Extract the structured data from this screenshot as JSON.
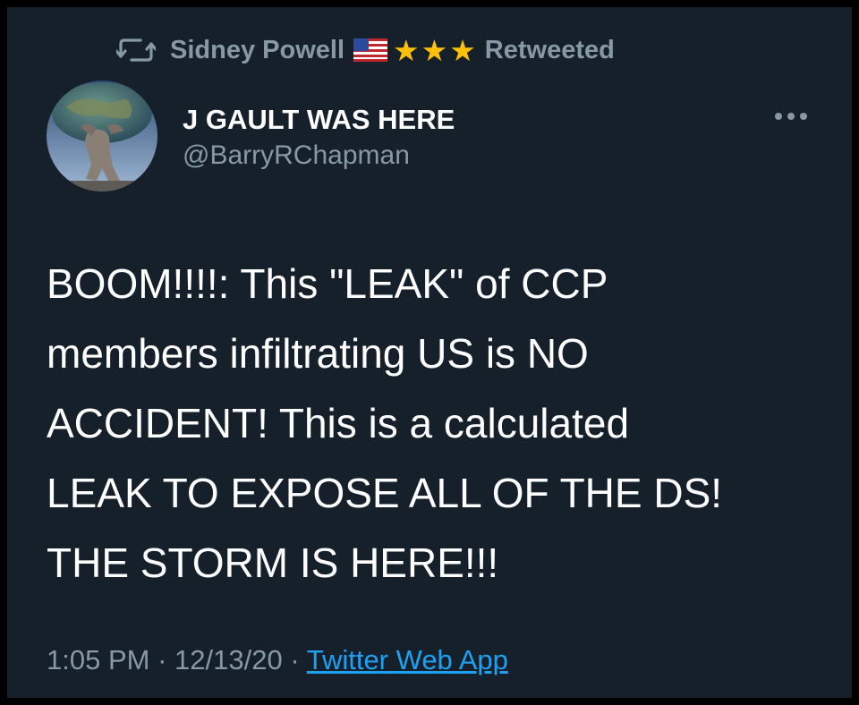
{
  "retweet_bar": {
    "retweeter": "Sidney Powell",
    "status": "Retweeted",
    "star_glyph": "★",
    "icons": [
      "retweet-icon",
      "us-flag-icon",
      "star-icon",
      "star-icon",
      "star-icon"
    ]
  },
  "author": {
    "display_name": "J GAULT WAS HERE",
    "handle": "@BarryRChapman"
  },
  "body_lines": [
    "BOOM!!!!:  This \"LEAK\" of CCP",
    "members infiltrating US is NO",
    "ACCIDENT! This is a calculated",
    "LEAK TO EXPOSE ALL OF THE DS!",
    "THE STORM IS HERE!!!"
  ],
  "meta": {
    "time": "1:05 PM",
    "separator": "·",
    "date": "12/13/20",
    "source": "Twitter Web App"
  },
  "colors": {
    "background": "#15202b",
    "secondary_text": "#8899a6",
    "link": "#1da1f2",
    "star": "#ffc107"
  }
}
